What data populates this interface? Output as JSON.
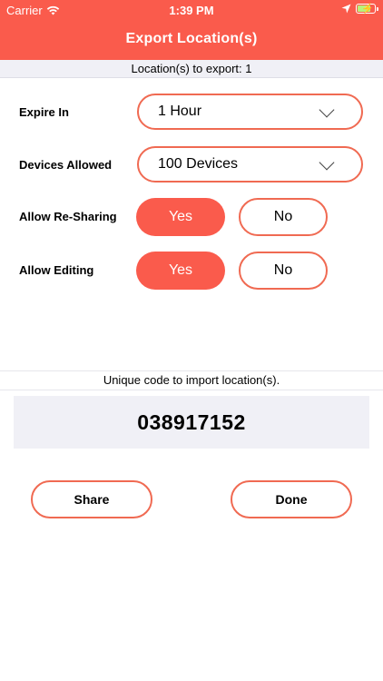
{
  "status_bar": {
    "carrier": "Carrier",
    "time": "1:39 PM",
    "wifi_icon": "wifi-icon",
    "location_icon": "location-arrow-icon",
    "battery_icon": "battery-charging-icon"
  },
  "nav": {
    "title": "Export Location(s)"
  },
  "export": {
    "count_label": "Location(s) to export: 1"
  },
  "form": {
    "expire": {
      "label": "Expire In",
      "value": "1 Hour"
    },
    "devices": {
      "label": "Devices Allowed",
      "value": "100 Devices"
    },
    "resharing": {
      "label": "Allow Re-Sharing",
      "yes": "Yes",
      "no": "No",
      "selected": "Yes"
    },
    "editing": {
      "label": "Allow Editing",
      "yes": "Yes",
      "no": "No",
      "selected": "Yes"
    }
  },
  "code": {
    "caption": "Unique code to import location(s).",
    "value": "038917152"
  },
  "actions": {
    "share": "Share",
    "done": "Done"
  },
  "colors": {
    "accent": "#fa5b4c",
    "outline": "#f06a52",
    "panel": "#f0f0f6",
    "battery": "#b9f27a"
  }
}
